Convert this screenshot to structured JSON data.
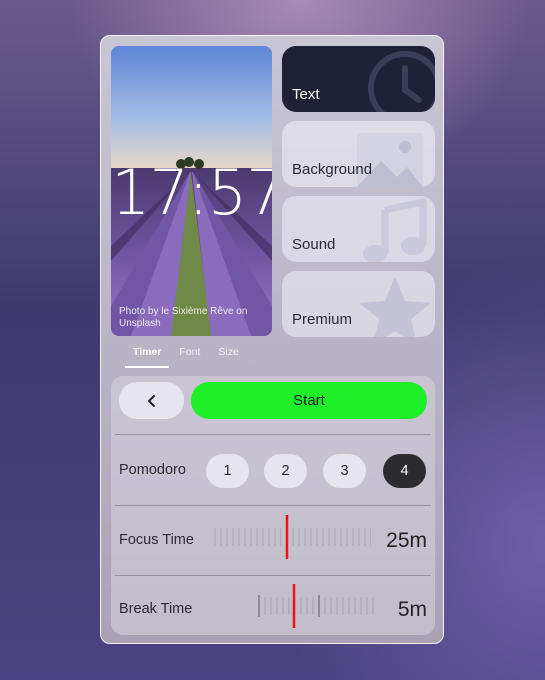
{
  "preview": {
    "clock": "17:57",
    "credit": "Photo by le Sixième Rêve on Unsplash"
  },
  "menu": [
    {
      "label": "Text",
      "icon": "clock-icon",
      "selected": true
    },
    {
      "label": "Background",
      "icon": "image-icon",
      "selected": false
    },
    {
      "label": "Sound",
      "icon": "music-note-icon",
      "selected": false
    },
    {
      "label": "Premium",
      "icon": "star-icon",
      "selected": false
    }
  ],
  "tabs": [
    {
      "label": "Timer",
      "active": true
    },
    {
      "label": "Font",
      "active": false
    },
    {
      "label": "Size",
      "active": false
    }
  ],
  "controls": {
    "back_icon": "chevron-left-icon",
    "start_label": "Start",
    "start_color": "#1ef02a",
    "pomodoro": {
      "label": "Pomodoro",
      "options": [
        "1",
        "2",
        "3",
        "4"
      ],
      "selected": "4"
    },
    "focus": {
      "label": "Focus Time",
      "value": "25m"
    },
    "break": {
      "label": "Break Time",
      "value": "5m"
    }
  }
}
